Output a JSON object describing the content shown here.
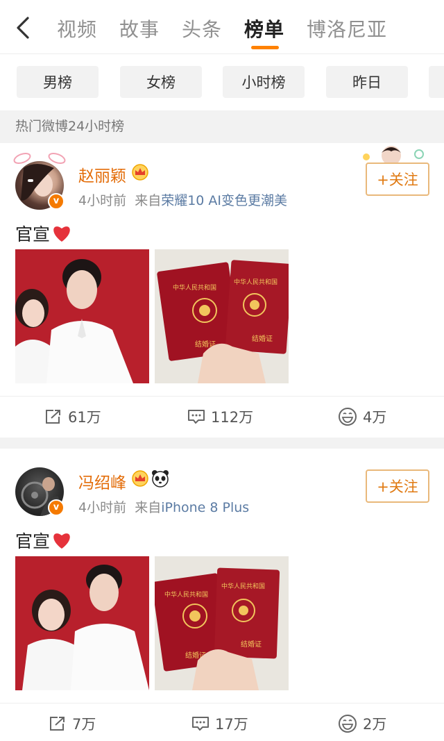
{
  "nav": {
    "tabs": [
      "视频",
      "故事",
      "头条",
      "榜单",
      "博洛尼亚"
    ],
    "active_tab": "榜单",
    "accent_color": "#ff8200"
  },
  "filters": [
    "男榜",
    "女榜",
    "小时榜",
    "昨日"
  ],
  "section_title": "热门微博24小时榜",
  "posts": [
    {
      "username": "赵丽颖",
      "time": "4小时前",
      "source_prefix": "来自",
      "source": "荣耀10 AI变色更潮美",
      "follow_label": "+关注",
      "text": "官宣",
      "reposts": "61万",
      "comments": "112万",
      "likes": "4万"
    },
    {
      "username": "冯绍峰",
      "time": "4小时前",
      "source_prefix": "来自",
      "source": "iPhone 8 Plus",
      "follow_label": "+关注",
      "text": "官宣",
      "reposts": "7万",
      "comments": "17万",
      "likes": "2万"
    }
  ],
  "passport_text": {
    "country": "中华人民共和国",
    "title_a": "结婚证",
    "title_b": "结婚证"
  }
}
